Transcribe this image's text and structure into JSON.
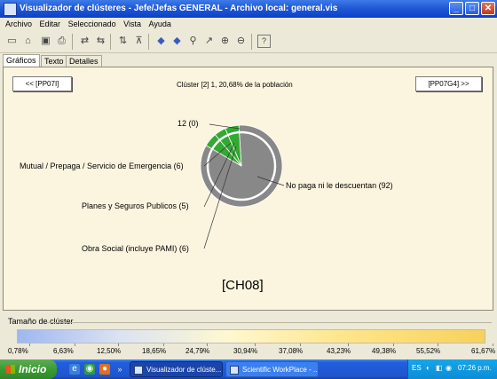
{
  "window": {
    "title": "Visualizador de clústeres - Jefe/Jefas GENERAL - Archivo local: general.vis",
    "minimize": "_",
    "maximize": "□",
    "close": "✕"
  },
  "menu": [
    "Archivo",
    "Editar",
    "Seleccionado",
    "Vista",
    "Ayuda"
  ],
  "toolbar": [
    "new-icon",
    "open-icon",
    "save-icon",
    "print-icon",
    "swap-icon",
    "swap-back-icon",
    "sort-icon",
    "filter-icon",
    "arrow-left-icon",
    "arrow-right-icon",
    "find-icon",
    "chart-icon",
    "zoom-in-icon",
    "zoom-out-icon",
    "help-icon"
  ],
  "tabs": [
    "Gráficos",
    "Texto",
    "Detalles"
  ],
  "panel": {
    "prev_button": "<< [PP07I]",
    "next_button": "[PP07G4] >>",
    "cluster_info": "Clúster [2] 1, 20,68% de la población",
    "code": "[CH08]"
  },
  "chart_data": {
    "type": "pie",
    "title": "",
    "slices": [
      {
        "label": "No paga ni le descuentan",
        "value": 92,
        "display": "No paga ni le descuentan (92)",
        "color": "#888888"
      },
      {
        "label": "Obra Social (incluye PAMI)",
        "value": 6,
        "display": "Obra Social (incluye PAMI) (6)",
        "color": "#33a833"
      },
      {
        "label": "Planes y Seguros Publicos",
        "value": 5,
        "display": "Planes y Seguros Publicos (5)",
        "color": "#33a833"
      },
      {
        "label": "Mutual / Prepaga / Servicio de Emergencia",
        "value": 6,
        "display": "Mutual / Prepaga / Servicio de Emergencia (6)",
        "color": "#33a833"
      },
      {
        "label": "12",
        "value": 0,
        "display": "12 (0)",
        "color": "#888888"
      }
    ]
  },
  "legend": {
    "title": "Tamaño de clúster",
    "ticks": [
      "0,78%",
      "6,63%",
      "12,50%",
      "18,65%",
      "24,79%",
      "30,94%",
      "37,08%",
      "43,23%",
      "49,38%",
      "55,52%",
      "61,67%"
    ]
  },
  "taskbar": {
    "start": "Inicio",
    "task_active": "Visualizador de clúste...",
    "task_other": "Scientific WorkPlace - ...",
    "lang": "ES",
    "time": "07:26 p.m."
  }
}
